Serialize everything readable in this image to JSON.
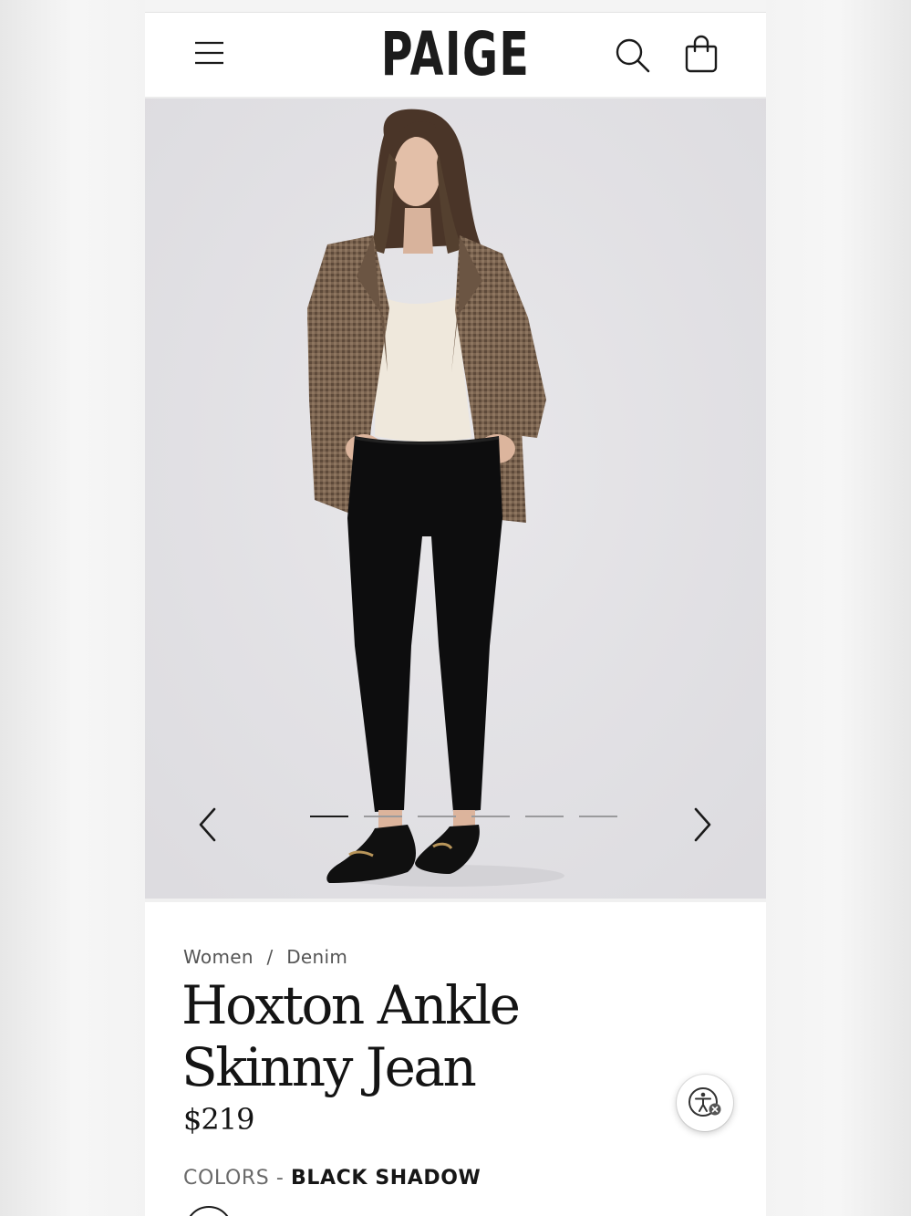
{
  "header": {
    "brand": "PAIGE",
    "icons": [
      "hamburger-menu-icon",
      "search-icon",
      "shopping-bag-icon"
    ]
  },
  "gallery": {
    "image_count": 6,
    "active_index": 0
  },
  "product": {
    "breadcrumb": [
      "Women",
      "Denim"
    ],
    "breadcrumb_separator": "/",
    "title_line1": "Hoxton Ankle",
    "title_line2": "Skinny Jean",
    "price": "$219",
    "colors_label": "COLORS -",
    "selected_color": "BLACK SHADOW"
  },
  "accessibility": {
    "icon": "accessibility-icon"
  },
  "colors": {
    "text": "#141414",
    "muted": "#6a6a6a",
    "background": "#ffffff",
    "hero_bg": "#e3e2e5"
  }
}
